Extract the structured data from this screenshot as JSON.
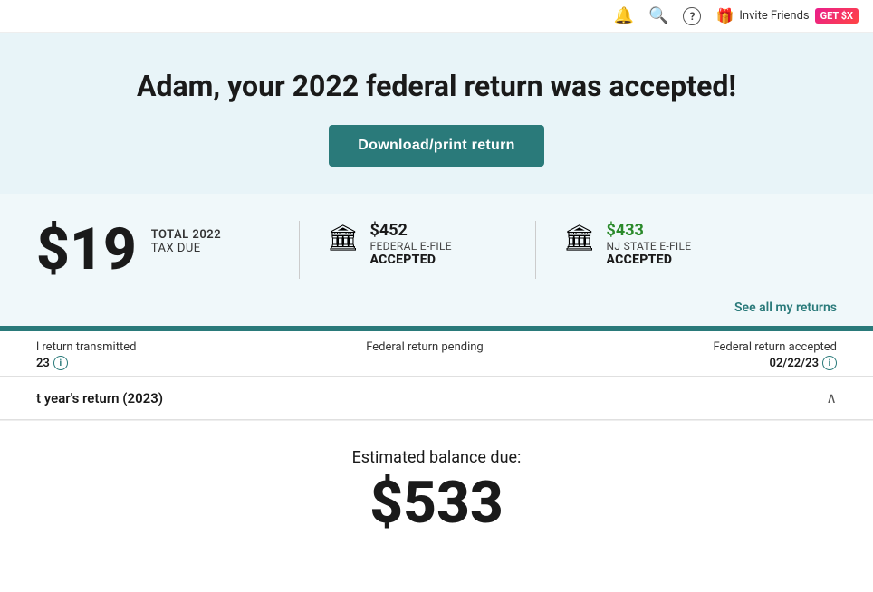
{
  "nav": {
    "invite_label": "Invite Friends",
    "get_badge": "GET $X",
    "bell_icon": "🔔",
    "search_icon": "🔍",
    "help_icon": "?"
  },
  "hero": {
    "title": "Adam, your 2022 federal return was accepted!",
    "download_btn_label": "Download/print return"
  },
  "summary": {
    "tax_due_amount": "$19",
    "tax_due_total_label": "TOTAL 2022",
    "tax_due_text": "TAX DUE",
    "federal": {
      "amount": "$452",
      "label": "FEDERAL E-FILE",
      "status": "ACCEPTED"
    },
    "nj_state": {
      "amount": "$433",
      "label": "NJ STATE E-FILE",
      "status": "ACCEPTED"
    },
    "see_returns_link": "See all my returns"
  },
  "progress": {
    "steps": [
      {
        "label": "l return transmitted",
        "date": "23",
        "has_info": true,
        "align": "left"
      },
      {
        "label": "Federal return pending",
        "date": "",
        "has_info": false,
        "align": "center"
      },
      {
        "label": "Federal return accepted",
        "date": "02/22/23",
        "has_info": true,
        "align": "right"
      }
    ]
  },
  "accordion": {
    "title": "t year's return (2023)",
    "chevron": "∧"
  },
  "balance": {
    "label": "Estimated balance due:",
    "amount": "$533"
  }
}
